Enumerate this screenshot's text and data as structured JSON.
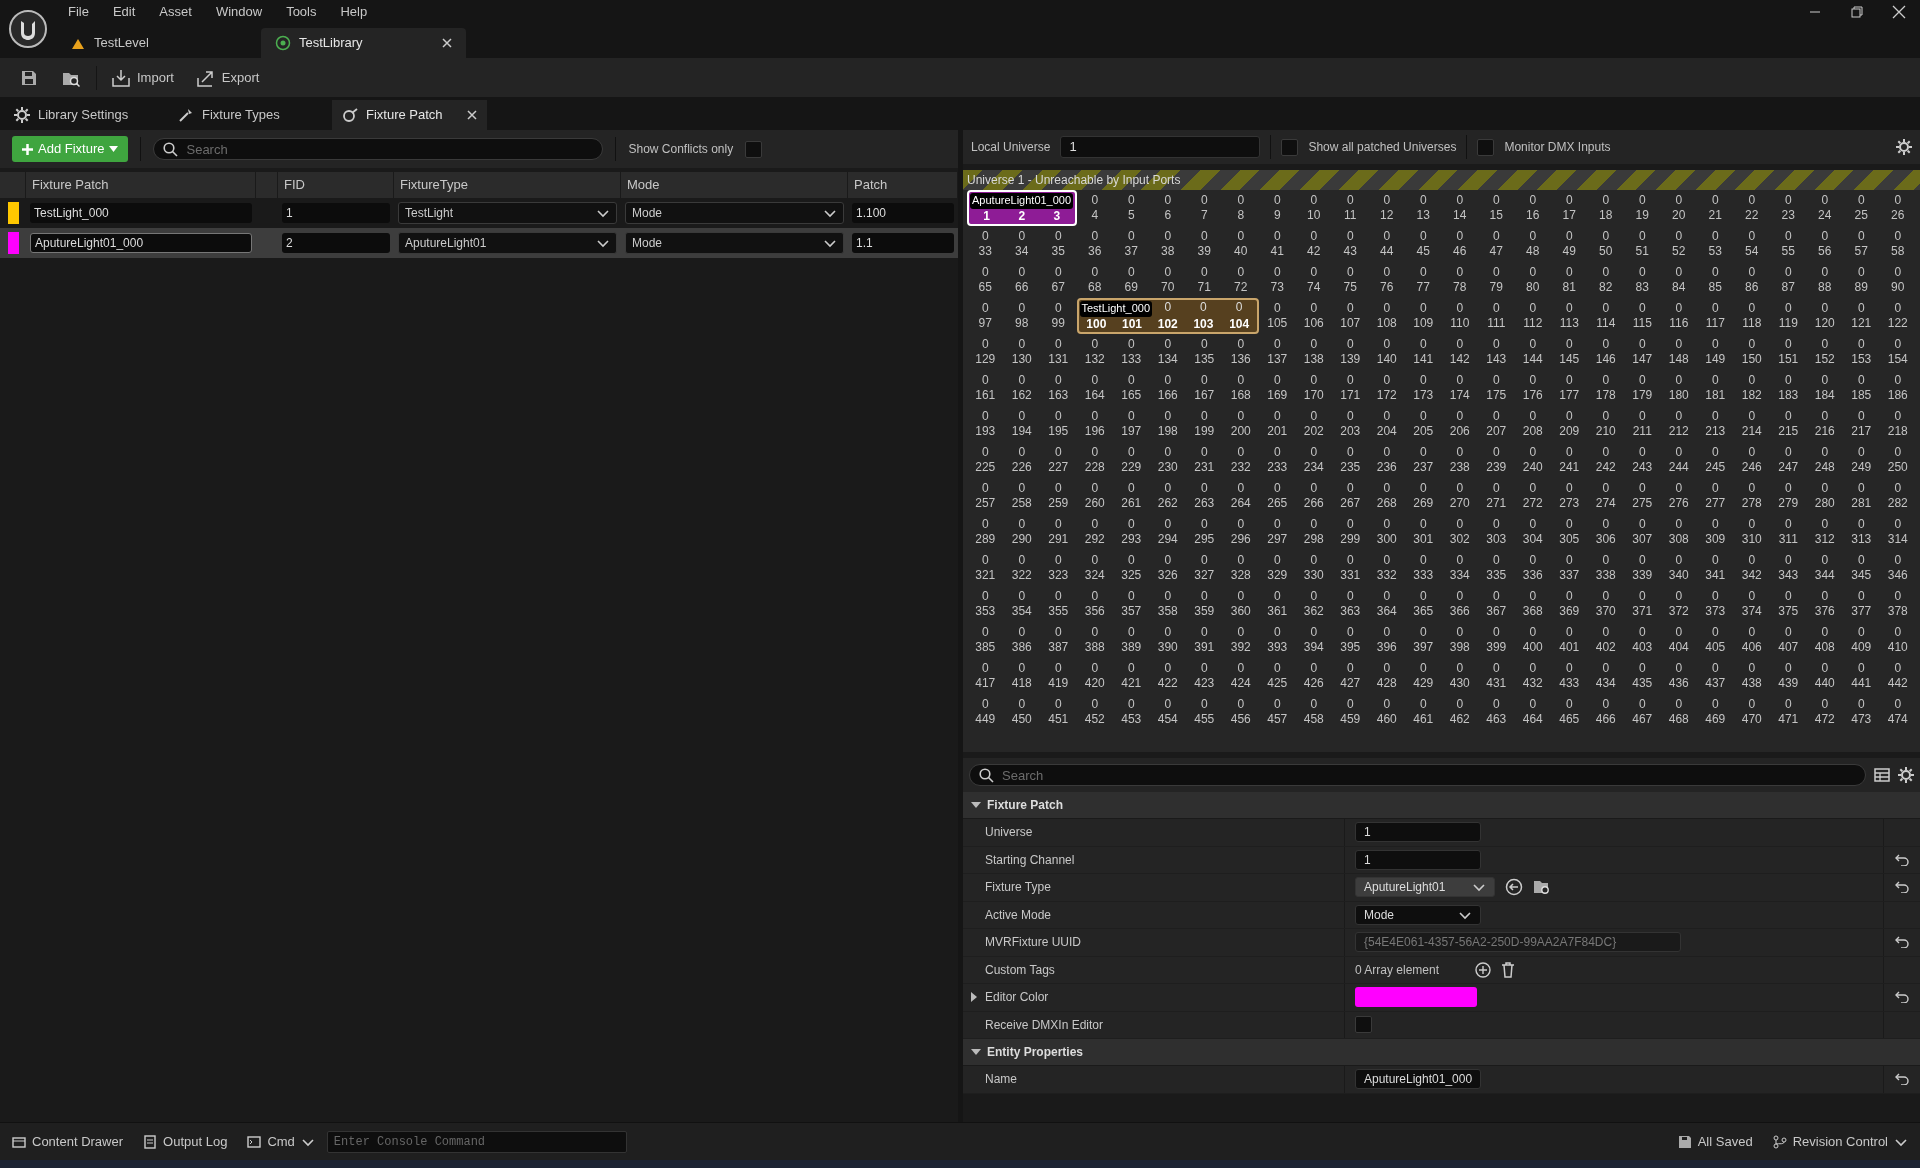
{
  "menu": [
    "File",
    "Edit",
    "Asset",
    "Window",
    "Tools",
    "Help"
  ],
  "doc_tabs": [
    {
      "label": "TestLevel",
      "kind": "level",
      "selected": false
    },
    {
      "label": "TestLibrary",
      "kind": "library",
      "selected": true
    }
  ],
  "toolbar": [
    {
      "kind": "save"
    },
    {
      "kind": "browse"
    },
    {
      "kind": "import",
      "label": "Import"
    },
    {
      "kind": "export",
      "label": "Export"
    }
  ],
  "panel_tabs": [
    {
      "label": "Library Settings",
      "kind": "settings",
      "selected": false
    },
    {
      "label": "Fixture Types",
      "kind": "types",
      "selected": false
    },
    {
      "label": "Fixture Patch",
      "kind": "patch",
      "selected": true
    }
  ],
  "patch_list": {
    "add_button": "Add Fixture",
    "search_placeholder": "Search",
    "conflicts_label": "Show Conflicts only",
    "conflicts_checked": false,
    "columns": [
      "Fixture Patch",
      "FID",
      "FixtureType",
      "Mode",
      "Patch"
    ],
    "rows": [
      {
        "color": "#ffc800",
        "name": "TestLight_000",
        "fid": "1",
        "fixture_type": "TestLight",
        "mode": "Mode",
        "patch": "1.100",
        "selected": false
      },
      {
        "color": "#ff00ff",
        "name": "AputureLight01_000",
        "fid": "2",
        "fixture_type": "AputureLight01",
        "mode": "Mode",
        "patch": "1.1",
        "selected": true
      }
    ]
  },
  "universe_bar": {
    "label": "Local Universe",
    "value": "1",
    "show_all_label": "Show all patched Universes",
    "show_all_checked": false,
    "monitor_label": "Monitor DMX Inputs",
    "monitor_checked": false
  },
  "dmx_grid": {
    "banner": "Universe 1 - Unreachable by Input Ports",
    "rows": [
      [
        {
          "kind": "patched",
          "channel": "1",
          "fixture": {
            "name": "AputureLight01_000",
            "color": "#8e1c96",
            "selected": true
          }
        },
        {
          "kind": "patched",
          "channel": "2"
        },
        {
          "kind": "patched",
          "channel": "3"
        },
        {
          "value": "0",
          "channel": "4"
        },
        {
          "value": "0",
          "channel": "5"
        },
        {
          "value": "0",
          "channel": "6"
        },
        {
          "value": "0",
          "channel": "7"
        },
        {
          "value": "0",
          "channel": "8"
        },
        {
          "value": "0",
          "channel": "9"
        },
        {
          "value": "0",
          "channel": "10"
        },
        {
          "value": "0",
          "channel": "11"
        },
        {
          "value": "0",
          "channel": "12"
        },
        {
          "value": "0",
          "channel": "13"
        },
        {
          "value": "0",
          "channel": "14"
        },
        {
          "value": "0",
          "channel": "15"
        },
        {
          "value": "0",
          "channel": "16"
        },
        {
          "value": "0",
          "channel": "17"
        },
        {
          "value": "0",
          "channel": "18"
        },
        {
          "value": "0",
          "channel": "19"
        },
        {
          "value": "0",
          "channel": "20"
        },
        {
          "value": "0",
          "channel": "21"
        },
        {
          "value": "0",
          "channel": "22"
        },
        {
          "value": "0",
          "channel": "23"
        },
        {
          "value": "0",
          "channel": "24"
        },
        {
          "value": "0",
          "channel": "25"
        },
        {
          "value": "0",
          "channel": "26"
        }
      ],
      [
        {
          "value": "0",
          "channel": "33"
        },
        {
          "value": "0",
          "channel": "34"
        },
        {
          "value": "0",
          "channel": "35"
        },
        {
          "value": "0",
          "channel": "36"
        },
        {
          "value": "0",
          "channel": "37"
        },
        {
          "value": "0",
          "channel": "38"
        },
        {
          "value": "0",
          "channel": "39"
        },
        {
          "value": "0",
          "channel": "40"
        },
        {
          "value": "0",
          "channel": "41"
        },
        {
          "value": "0",
          "channel": "42"
        },
        {
          "value": "0",
          "channel": "43"
        },
        {
          "value": "0",
          "channel": "44"
        },
        {
          "value": "0",
          "channel": "45"
        },
        {
          "value": "0",
          "channel": "46"
        },
        {
          "value": "0",
          "channel": "47"
        },
        {
          "value": "0",
          "channel": "48"
        },
        {
          "value": "0",
          "channel": "49"
        },
        {
          "value": "0",
          "channel": "50"
        },
        {
          "value": "0",
          "channel": "51"
        },
        {
          "value": "0",
          "channel": "52"
        },
        {
          "value": "0",
          "channel": "53"
        },
        {
          "value": "0",
          "channel": "54"
        },
        {
          "value": "0",
          "channel": "55"
        },
        {
          "value": "0",
          "channel": "56"
        },
        {
          "value": "0",
          "channel": "57"
        },
        {
          "value": "0",
          "channel": "58"
        }
      ],
      [
        {
          "value": "0",
          "channel": "65"
        },
        {
          "value": "0",
          "channel": "66"
        },
        {
          "value": "0",
          "channel": "67"
        },
        {
          "value": "0",
          "channel": "68"
        },
        {
          "value": "0",
          "channel": "69"
        },
        {
          "value": "0",
          "channel": "70"
        },
        {
          "value": "0",
          "channel": "71"
        },
        {
          "value": "0",
          "channel": "72"
        },
        {
          "value": "0",
          "channel": "73"
        },
        {
          "value": "0",
          "channel": "74"
        },
        {
          "value": "0",
          "channel": "75"
        },
        {
          "value": "0",
          "channel": "76"
        },
        {
          "value": "0",
          "channel": "77"
        },
        {
          "value": "0",
          "channel": "78"
        },
        {
          "value": "0",
          "channel": "79"
        },
        {
          "value": "0",
          "channel": "80"
        },
        {
          "value": "0",
          "channel": "81"
        },
        {
          "value": "0",
          "channel": "82"
        },
        {
          "value": "0",
          "channel": "83"
        },
        {
          "value": "0",
          "channel": "84"
        },
        {
          "value": "0",
          "channel": "85"
        },
        {
          "value": "0",
          "channel": "86"
        },
        {
          "value": "0",
          "channel": "87"
        },
        {
          "value": "0",
          "channel": "88"
        },
        {
          "value": "0",
          "channel": "89"
        },
        {
          "value": "0",
          "channel": "90"
        }
      ],
      [
        {
          "value": "0",
          "channel": "97"
        },
        {
          "value": "0",
          "channel": "98"
        },
        {
          "value": "0",
          "channel": "99"
        },
        {
          "kind": "patched",
          "channel": "100",
          "fixture": {
            "name": "TestLight_000",
            "color": "#56401f",
            "selected": false
          }
        },
        {
          "kind": "patched",
          "channel": "101"
        },
        {
          "kind": "patched",
          "value": "0",
          "channel": "102"
        },
        {
          "kind": "patched",
          "value": "0",
          "channel": "103"
        },
        {
          "kind": "patched",
          "value": "0",
          "channel": "104"
        },
        {
          "value": "0",
          "channel": "105"
        },
        {
          "value": "0",
          "channel": "106"
        },
        {
          "value": "0",
          "channel": "107"
        },
        {
          "value": "0",
          "channel": "108"
        },
        {
          "value": "0",
          "channel": "109"
        },
        {
          "value": "0",
          "channel": "110"
        },
        {
          "value": "0",
          "channel": "111"
        },
        {
          "value": "0",
          "channel": "112"
        },
        {
          "value": "0",
          "channel": "113"
        },
        {
          "value": "0",
          "channel": "114"
        },
        {
          "value": "0",
          "channel": "115"
        },
        {
          "value": "0",
          "channel": "116"
        },
        {
          "value": "0",
          "channel": "117"
        },
        {
          "value": "0",
          "channel": "118"
        },
        {
          "value": "0",
          "channel": "119"
        },
        {
          "value": "0",
          "channel": "120"
        },
        {
          "value": "0",
          "channel": "121"
        },
        {
          "value": "0",
          "channel": "122"
        }
      ],
      [
        {
          "value": "0",
          "channel": "129"
        },
        {
          "value": "0",
          "channel": "130"
        },
        {
          "value": "0",
          "channel": "131"
        },
        {
          "value": "0",
          "channel": "132"
        },
        {
          "value": "0",
          "channel": "133"
        },
        {
          "value": "0",
          "channel": "134"
        },
        {
          "value": "0",
          "channel": "135"
        },
        {
          "value": "0",
          "channel": "136"
        },
        {
          "value": "0",
          "channel": "137"
        },
        {
          "value": "0",
          "channel": "138"
        },
        {
          "value": "0",
          "channel": "139"
        },
        {
          "value": "0",
          "channel": "140"
        },
        {
          "value": "0",
          "channel": "141"
        },
        {
          "value": "0",
          "channel": "142"
        },
        {
          "value": "0",
          "channel": "143"
        },
        {
          "value": "0",
          "channel": "144"
        },
        {
          "value": "0",
          "channel": "145"
        },
        {
          "value": "0",
          "channel": "146"
        },
        {
          "value": "0",
          "channel": "147"
        },
        {
          "value": "0",
          "channel": "148"
        },
        {
          "value": "0",
          "channel": "149"
        },
        {
          "value": "0",
          "channel": "150"
        },
        {
          "value": "0",
          "channel": "151"
        },
        {
          "value": "0",
          "channel": "152"
        },
        {
          "value": "0",
          "channel": "153"
        },
        {
          "value": "0",
          "channel": "154"
        }
      ],
      [
        {
          "value": "0",
          "channel": "161"
        },
        {
          "value": "0",
          "channel": "162"
        },
        {
          "value": "0",
          "channel": "163"
        },
        {
          "value": "0",
          "channel": "164"
        },
        {
          "value": "0",
          "channel": "165"
        },
        {
          "value": "0",
          "channel": "166"
        },
        {
          "value": "0",
          "channel": "167"
        },
        {
          "value": "0",
          "channel": "168"
        },
        {
          "value": "0",
          "channel": "169"
        },
        {
          "value": "0",
          "channel": "170"
        },
        {
          "value": "0",
          "channel": "171"
        },
        {
          "value": "0",
          "channel": "172"
        },
        {
          "value": "0",
          "channel": "173"
        },
        {
          "value": "0",
          "channel": "174"
        },
        {
          "value": "0",
          "channel": "175"
        },
        {
          "value": "0",
          "channel": "176"
        },
        {
          "value": "0",
          "channel": "177"
        },
        {
          "value": "0",
          "channel": "178"
        },
        {
          "value": "0",
          "channel": "179"
        },
        {
          "value": "0",
          "channel": "180"
        },
        {
          "value": "0",
          "channel": "181"
        },
        {
          "value": "0",
          "channel": "182"
        },
        {
          "value": "0",
          "channel": "183"
        },
        {
          "value": "0",
          "channel": "184"
        },
        {
          "value": "0",
          "channel": "185"
        },
        {
          "value": "0",
          "channel": "186"
        }
      ],
      [
        {
          "value": "0",
          "channel": "193"
        },
        {
          "value": "0",
          "channel": "194"
        },
        {
          "value": "0",
          "channel": "195"
        },
        {
          "value": "0",
          "channel": "196"
        },
        {
          "value": "0",
          "channel": "197"
        },
        {
          "value": "0",
          "channel": "198"
        },
        {
          "value": "0",
          "channel": "199"
        },
        {
          "value": "0",
          "channel": "200"
        },
        {
          "value": "0",
          "channel": "201"
        },
        {
          "value": "0",
          "channel": "202"
        },
        {
          "value": "0",
          "channel": "203"
        },
        {
          "value": "0",
          "channel": "204"
        },
        {
          "value": "0",
          "channel": "205"
        },
        {
          "value": "0",
          "channel": "206"
        },
        {
          "value": "0",
          "channel": "207"
        },
        {
          "value": "0",
          "channel": "208"
        },
        {
          "value": "0",
          "channel": "209"
        },
        {
          "value": "0",
          "channel": "210"
        },
        {
          "value": "0",
          "channel": "211"
        },
        {
          "value": "0",
          "channel": "212"
        },
        {
          "value": "0",
          "channel": "213"
        },
        {
          "value": "0",
          "channel": "214"
        },
        {
          "value": "0",
          "channel": "215"
        },
        {
          "value": "0",
          "channel": "216"
        },
        {
          "value": "0",
          "channel": "217"
        },
        {
          "value": "0",
          "channel": "218"
        }
      ],
      [
        {
          "value": "0",
          "channel": "225"
        },
        {
          "value": "0",
          "channel": "226"
        },
        {
          "value": "0",
          "channel": "227"
        },
        {
          "value": "0",
          "channel": "228"
        },
        {
          "value": "0",
          "channel": "229"
        },
        {
          "value": "0",
          "channel": "230"
        },
        {
          "value": "0",
          "channel": "231"
        },
        {
          "value": "0",
          "channel": "232"
        },
        {
          "value": "0",
          "channel": "233"
        },
        {
          "value": "0",
          "channel": "234"
        },
        {
          "value": "0",
          "channel": "235"
        },
        {
          "value": "0",
          "channel": "236"
        },
        {
          "value": "0",
          "channel": "237"
        },
        {
          "value": "0",
          "channel": "238"
        },
        {
          "value": "0",
          "channel": "239"
        },
        {
          "value": "0",
          "channel": "240"
        },
        {
          "value": "0",
          "channel": "241"
        },
        {
          "value": "0",
          "channel": "242"
        },
        {
          "value": "0",
          "channel": "243"
        },
        {
          "value": "0",
          "channel": "244"
        },
        {
          "value": "0",
          "channel": "245"
        },
        {
          "value": "0",
          "channel": "246"
        },
        {
          "value": "0",
          "channel": "247"
        },
        {
          "value": "0",
          "channel": "248"
        },
        {
          "value": "0",
          "channel": "249"
        },
        {
          "value": "0",
          "channel": "250"
        }
      ],
      [
        {
          "value": "0",
          "channel": "257"
        },
        {
          "value": "0",
          "channel": "258"
        },
        {
          "value": "0",
          "channel": "259"
        },
        {
          "value": "0",
          "channel": "260"
        },
        {
          "value": "0",
          "channel": "261"
        },
        {
          "value": "0",
          "channel": "262"
        },
        {
          "value": "0",
          "channel": "263"
        },
        {
          "value": "0",
          "channel": "264"
        },
        {
          "value": "0",
          "channel": "265"
        },
        {
          "value": "0",
          "channel": "266"
        },
        {
          "value": "0",
          "channel": "267"
        },
        {
          "value": "0",
          "channel": "268"
        },
        {
          "value": "0",
          "channel": "269"
        },
        {
          "value": "0",
          "channel": "270"
        },
        {
          "value": "0",
          "channel": "271"
        },
        {
          "value": "0",
          "channel": "272"
        },
        {
          "value": "0",
          "channel": "273"
        },
        {
          "value": "0",
          "channel": "274"
        },
        {
          "value": "0",
          "channel": "275"
        },
        {
          "value": "0",
          "channel": "276"
        },
        {
          "value": "0",
          "channel": "277"
        },
        {
          "value": "0",
          "channel": "278"
        },
        {
          "value": "0",
          "channel": "279"
        },
        {
          "value": "0",
          "channel": "280"
        },
        {
          "value": "0",
          "channel": "281"
        },
        {
          "value": "0",
          "channel": "282"
        }
      ],
      [
        {
          "value": "0",
          "channel": "289"
        },
        {
          "value": "0",
          "channel": "290"
        },
        {
          "value": "0",
          "channel": "291"
        },
        {
          "value": "0",
          "channel": "292"
        },
        {
          "value": "0",
          "channel": "293"
        },
        {
          "value": "0",
          "channel": "294"
        },
        {
          "value": "0",
          "channel": "295"
        },
        {
          "value": "0",
          "channel": "296"
        },
        {
          "value": "0",
          "channel": "297"
        },
        {
          "value": "0",
          "channel": "298"
        },
        {
          "value": "0",
          "channel": "299"
        },
        {
          "value": "0",
          "channel": "300"
        },
        {
          "value": "0",
          "channel": "301"
        },
        {
          "value": "0",
          "channel": "302"
        },
        {
          "value": "0",
          "channel": "303"
        },
        {
          "value": "0",
          "channel": "304"
        },
        {
          "value": "0",
          "channel": "305"
        },
        {
          "value": "0",
          "channel": "306"
        },
        {
          "value": "0",
          "channel": "307"
        },
        {
          "value": "0",
          "channel": "308"
        },
        {
          "value": "0",
          "channel": "309"
        },
        {
          "value": "0",
          "channel": "310"
        },
        {
          "value": "0",
          "channel": "311"
        },
        {
          "value": "0",
          "channel": "312"
        },
        {
          "value": "0",
          "channel": "313"
        },
        {
          "value": "0",
          "channel": "314"
        }
      ],
      [
        {
          "value": "0",
          "channel": "321"
        },
        {
          "value": "0",
          "channel": "322"
        },
        {
          "value": "0",
          "channel": "323"
        },
        {
          "value": "0",
          "channel": "324"
        },
        {
          "value": "0",
          "channel": "325"
        },
        {
          "value": "0",
          "channel": "326"
        },
        {
          "value": "0",
          "channel": "327"
        },
        {
          "value": "0",
          "channel": "328"
        },
        {
          "value": "0",
          "channel": "329"
        },
        {
          "value": "0",
          "channel": "330"
        },
        {
          "value": "0",
          "channel": "331"
        },
        {
          "value": "0",
          "channel": "332"
        },
        {
          "value": "0",
          "channel": "333"
        },
        {
          "value": "0",
          "channel": "334"
        },
        {
          "value": "0",
          "channel": "335"
        },
        {
          "value": "0",
          "channel": "336"
        },
        {
          "value": "0",
          "channel": "337"
        },
        {
          "value": "0",
          "channel": "338"
        },
        {
          "value": "0",
          "channel": "339"
        },
        {
          "value": "0",
          "channel": "340"
        },
        {
          "value": "0",
          "channel": "341"
        },
        {
          "value": "0",
          "channel": "342"
        },
        {
          "value": "0",
          "channel": "343"
        },
        {
          "value": "0",
          "channel": "344"
        },
        {
          "value": "0",
          "channel": "345"
        },
        {
          "value": "0",
          "channel": "346"
        }
      ],
      [
        {
          "value": "0",
          "channel": "353"
        },
        {
          "value": "0",
          "channel": "354"
        },
        {
          "value": "0",
          "channel": "355"
        },
        {
          "value": "0",
          "channel": "356"
        },
        {
          "value": "0",
          "channel": "357"
        },
        {
          "value": "0",
          "channel": "358"
        },
        {
          "value": "0",
          "channel": "359"
        },
        {
          "value": "0",
          "channel": "360"
        },
        {
          "value": "0",
          "channel": "361"
        },
        {
          "value": "0",
          "channel": "362"
        },
        {
          "value": "0",
          "channel": "363"
        },
        {
          "value": "0",
          "channel": "364"
        },
        {
          "value": "0",
          "channel": "365"
        },
        {
          "value": "0",
          "channel": "366"
        },
        {
          "value": "0",
          "channel": "367"
        },
        {
          "value": "0",
          "channel": "368"
        },
        {
          "value": "0",
          "channel": "369"
        },
        {
          "value": "0",
          "channel": "370"
        },
        {
          "value": "0",
          "channel": "371"
        },
        {
          "value": "0",
          "channel": "372"
        },
        {
          "value": "0",
          "channel": "373"
        },
        {
          "value": "0",
          "channel": "374"
        },
        {
          "value": "0",
          "channel": "375"
        },
        {
          "value": "0",
          "channel": "376"
        },
        {
          "value": "0",
          "channel": "377"
        },
        {
          "value": "0",
          "channel": "378"
        }
      ],
      [
        {
          "value": "0",
          "channel": "385"
        },
        {
          "value": "0",
          "channel": "386"
        },
        {
          "value": "0",
          "channel": "387"
        },
        {
          "value": "0",
          "channel": "388"
        },
        {
          "value": "0",
          "channel": "389"
        },
        {
          "value": "0",
          "channel": "390"
        },
        {
          "value": "0",
          "channel": "391"
        },
        {
          "value": "0",
          "channel": "392"
        },
        {
          "value": "0",
          "channel": "393"
        },
        {
          "value": "0",
          "channel": "394"
        },
        {
          "value": "0",
          "channel": "395"
        },
        {
          "value": "0",
          "channel": "396"
        },
        {
          "value": "0",
          "channel": "397"
        },
        {
          "value": "0",
          "channel": "398"
        },
        {
          "value": "0",
          "channel": "399"
        },
        {
          "value": "0",
          "channel": "400"
        },
        {
          "value": "0",
          "channel": "401"
        },
        {
          "value": "0",
          "channel": "402"
        },
        {
          "value": "0",
          "channel": "403"
        },
        {
          "value": "0",
          "channel": "404"
        },
        {
          "value": "0",
          "channel": "405"
        },
        {
          "value": "0",
          "channel": "406"
        },
        {
          "value": "0",
          "channel": "407"
        },
        {
          "value": "0",
          "channel": "408"
        },
        {
          "value": "0",
          "channel": "409"
        },
        {
          "value": "0",
          "channel": "410"
        }
      ],
      [
        {
          "value": "0",
          "channel": "417"
        },
        {
          "value": "0",
          "channel": "418"
        },
        {
          "value": "0",
          "channel": "419"
        },
        {
          "value": "0",
          "channel": "420"
        },
        {
          "value": "0",
          "channel": "421"
        },
        {
          "value": "0",
          "channel": "422"
        },
        {
          "value": "0",
          "channel": "423"
        },
        {
          "value": "0",
          "channel": "424"
        },
        {
          "value": "0",
          "channel": "425"
        },
        {
          "value": "0",
          "channel": "426"
        },
        {
          "value": "0",
          "channel": "427"
        },
        {
          "value": "0",
          "channel": "428"
        },
        {
          "value": "0",
          "channel": "429"
        },
        {
          "value": "0",
          "channel": "430"
        },
        {
          "value": "0",
          "channel": "431"
        },
        {
          "value": "0",
          "channel": "432"
        },
        {
          "value": "0",
          "channel": "433"
        },
        {
          "value": "0",
          "channel": "434"
        },
        {
          "value": "0",
          "channel": "435"
        },
        {
          "value": "0",
          "channel": "436"
        },
        {
          "value": "0",
          "channel": "437"
        },
        {
          "value": "0",
          "channel": "438"
        },
        {
          "value": "0",
          "channel": "439"
        },
        {
          "value": "0",
          "channel": "440"
        },
        {
          "value": "0",
          "channel": "441"
        },
        {
          "value": "0",
          "channel": "442"
        }
      ],
      [
        {
          "value": "0",
          "channel": "449"
        },
        {
          "value": "0",
          "channel": "450"
        },
        {
          "value": "0",
          "channel": "451"
        },
        {
          "value": "0",
          "channel": "452"
        },
        {
          "value": "0",
          "channel": "453"
        },
        {
          "value": "0",
          "channel": "454"
        },
        {
          "value": "0",
          "channel": "455"
        },
        {
          "value": "0",
          "channel": "456"
        },
        {
          "value": "0",
          "channel": "457"
        },
        {
          "value": "0",
          "channel": "458"
        },
        {
          "value": "0",
          "channel": "459"
        },
        {
          "value": "0",
          "channel": "460"
        },
        {
          "value": "0",
          "channel": "461"
        },
        {
          "value": "0",
          "channel": "462"
        },
        {
          "value": "0",
          "channel": "463"
        },
        {
          "value": "0",
          "channel": "464"
        },
        {
          "value": "0",
          "channel": "465"
        },
        {
          "value": "0",
          "channel": "466"
        },
        {
          "value": "0",
          "channel": "467"
        },
        {
          "value": "0",
          "channel": "468"
        },
        {
          "value": "0",
          "channel": "469"
        },
        {
          "value": "0",
          "channel": "470"
        },
        {
          "value": "0",
          "channel": "471"
        },
        {
          "value": "0",
          "channel": "472"
        },
        {
          "value": "0",
          "channel": "473"
        },
        {
          "value": "0",
          "channel": "474"
        }
      ]
    ]
  },
  "details": {
    "search_placeholder": "Search",
    "sections": [
      {
        "title": "Fixture Patch",
        "expanded": true,
        "rows": [
          {
            "kind": "field",
            "label": "Universe",
            "value": "1",
            "resettable": false
          },
          {
            "kind": "field",
            "label": "Starting Channel",
            "value": "1",
            "resettable": true
          },
          {
            "kind": "combo",
            "label": "Fixture Type",
            "value": "AputureLight01",
            "resettable": true
          },
          {
            "kind": "dropdown",
            "label": "Active Mode",
            "value": "Mode",
            "resettable": false
          },
          {
            "kind": "readonly",
            "label": "MVRFixture UUID",
            "value": "{54E4E061-4357-56A2-250D-99AA2A7F84DC}",
            "resettable": true
          },
          {
            "kind": "array",
            "label": "Custom Tags",
            "value": "0 Array element",
            "resettable": false
          },
          {
            "kind": "color",
            "label": "Editor Color",
            "color": "#ff00ff",
            "expanded": false,
            "resettable": true
          },
          {
            "kind": "checkbox",
            "label": "Receive DMXIn Editor",
            "checked": false,
            "resettable": false
          }
        ]
      },
      {
        "title": "Entity Properties",
        "expanded": true,
        "rows": [
          {
            "kind": "field",
            "label": "Name",
            "value": "AputureLight01_000",
            "resettable": true
          }
        ]
      }
    ]
  },
  "status_bar": {
    "content_drawer": "Content Drawer",
    "output_log": "Output Log",
    "cmd": "Cmd",
    "console_placeholder": "Enter Console Command",
    "saved": "All Saved",
    "revision": "Revision Control"
  }
}
